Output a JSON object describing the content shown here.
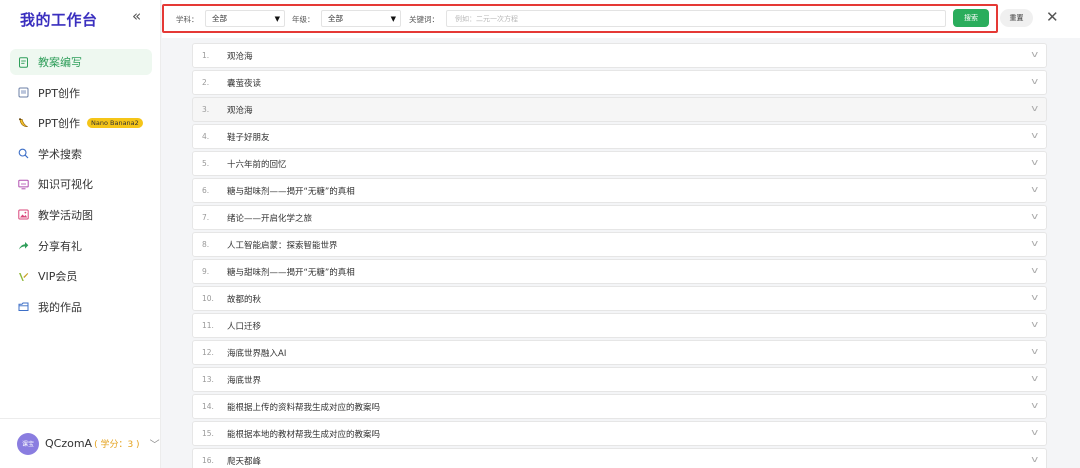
{
  "sidebar": {
    "brand": "我的工作台",
    "collapse_icon": "«",
    "items": [
      {
        "label": "教案编写",
        "icon": "doc-edit-icon",
        "active": true
      },
      {
        "label": "PPT创作",
        "icon": "ppt-icon"
      },
      {
        "label": "PPT创作",
        "icon": "banana-icon",
        "badge": "Nano Banana2"
      },
      {
        "label": "学术搜索",
        "icon": "search-icon"
      },
      {
        "label": "知识可视化",
        "icon": "monitor-icon"
      },
      {
        "label": "教学活动图",
        "icon": "image-icon"
      },
      {
        "label": "分享有礼",
        "icon": "share-arrow-icon"
      },
      {
        "label": "VIP会员",
        "icon": "vip-icon"
      },
      {
        "label": "我的作品",
        "icon": "folder-icon"
      }
    ],
    "user": {
      "avatar_text": "课宝",
      "name": "QCzomA",
      "points_label": "( 学分：3 )"
    }
  },
  "filters": {
    "subject_label": "学科：",
    "subject_value": "全部",
    "grade_label": "年级：",
    "grade_value": "全部",
    "keyword_label": "关键词：",
    "keyword_placeholder": "例如：二元一次方程",
    "search_button": "搜索",
    "reset_button": "重置",
    "close_icon": "✕"
  },
  "lessons": [
    {
      "num": "1.",
      "title": "观沧海"
    },
    {
      "num": "2.",
      "title": "囊萤夜读"
    },
    {
      "num": "3.",
      "title": "观沧海"
    },
    {
      "num": "4.",
      "title": "鞋子好朋友"
    },
    {
      "num": "5.",
      "title": "十六年前的回忆"
    },
    {
      "num": "6.",
      "title": "糖与甜味剂——揭开“无糖”的真相"
    },
    {
      "num": "7.",
      "title": "绪论——开启化学之旅"
    },
    {
      "num": "8.",
      "title": "人工智能启蒙：探索智能世界"
    },
    {
      "num": "9.",
      "title": "糖与甜味剂——揭开“无糖”的真相"
    },
    {
      "num": "10.",
      "title": "故都的秋"
    },
    {
      "num": "11.",
      "title": "人口迁移"
    },
    {
      "num": "12.",
      "title": "海底世界融入AI"
    },
    {
      "num": "13.",
      "title": "海底世界"
    },
    {
      "num": "14.",
      "title": "能根据上传的资料帮我生成对应的教案吗"
    },
    {
      "num": "15.",
      "title": "能根据本地的教材帮我生成对应的教案吗"
    },
    {
      "num": "16.",
      "title": "爬天都峰"
    }
  ]
}
